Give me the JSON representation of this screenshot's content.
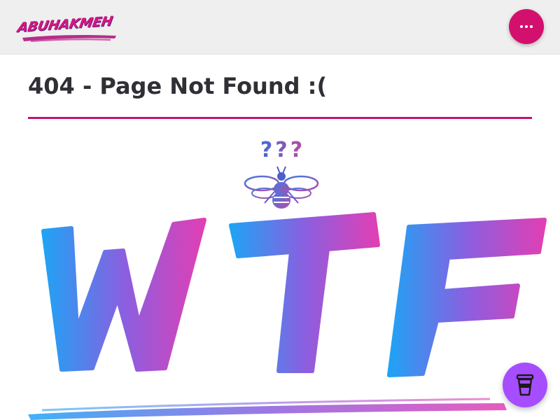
{
  "header": {
    "logo_text": "ABUHAKMEH",
    "menu_icon": "more-horizontal-icon"
  },
  "main": {
    "title": "404 - Page Not Found :(",
    "illustration": {
      "question_marks": "???",
      "big_text": "WTF",
      "icon": "bee-icon"
    }
  },
  "floating_button": {
    "icon": "coffee-cup-icon"
  },
  "colors": {
    "accent": "#d4106e",
    "header_bg": "#efefef",
    "title_text": "#2f2f35",
    "gradient_start": "#1fa3f5",
    "gradient_mid": "#8a5fe0",
    "gradient_end": "#e13fb4",
    "bmc_button": "#a64dff"
  }
}
